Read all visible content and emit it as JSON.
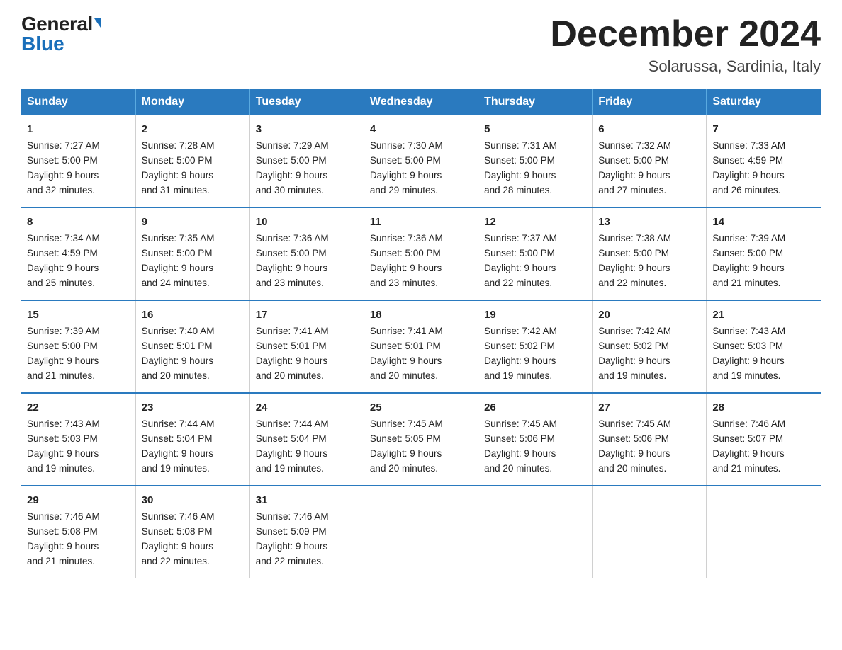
{
  "logo": {
    "general": "General",
    "blue": "Blue",
    "arrow": "▶"
  },
  "title": "December 2024",
  "subtitle": "Solarussa, Sardinia, Italy",
  "days": [
    "Sunday",
    "Monday",
    "Tuesday",
    "Wednesday",
    "Thursday",
    "Friday",
    "Saturday"
  ],
  "weeks": [
    [
      {
        "day": "1",
        "sunrise": "7:27 AM",
        "sunset": "5:00 PM",
        "daylight": "9 hours and 32 minutes."
      },
      {
        "day": "2",
        "sunrise": "7:28 AM",
        "sunset": "5:00 PM",
        "daylight": "9 hours and 31 minutes."
      },
      {
        "day": "3",
        "sunrise": "7:29 AM",
        "sunset": "5:00 PM",
        "daylight": "9 hours and 30 minutes."
      },
      {
        "day": "4",
        "sunrise": "7:30 AM",
        "sunset": "5:00 PM",
        "daylight": "9 hours and 29 minutes."
      },
      {
        "day": "5",
        "sunrise": "7:31 AM",
        "sunset": "5:00 PM",
        "daylight": "9 hours and 28 minutes."
      },
      {
        "day": "6",
        "sunrise": "7:32 AM",
        "sunset": "5:00 PM",
        "daylight": "9 hours and 27 minutes."
      },
      {
        "day": "7",
        "sunrise": "7:33 AM",
        "sunset": "4:59 PM",
        "daylight": "9 hours and 26 minutes."
      }
    ],
    [
      {
        "day": "8",
        "sunrise": "7:34 AM",
        "sunset": "4:59 PM",
        "daylight": "9 hours and 25 minutes."
      },
      {
        "day": "9",
        "sunrise": "7:35 AM",
        "sunset": "5:00 PM",
        "daylight": "9 hours and 24 minutes."
      },
      {
        "day": "10",
        "sunrise": "7:36 AM",
        "sunset": "5:00 PM",
        "daylight": "9 hours and 23 minutes."
      },
      {
        "day": "11",
        "sunrise": "7:36 AM",
        "sunset": "5:00 PM",
        "daylight": "9 hours and 23 minutes."
      },
      {
        "day": "12",
        "sunrise": "7:37 AM",
        "sunset": "5:00 PM",
        "daylight": "9 hours and 22 minutes."
      },
      {
        "day": "13",
        "sunrise": "7:38 AM",
        "sunset": "5:00 PM",
        "daylight": "9 hours and 22 minutes."
      },
      {
        "day": "14",
        "sunrise": "7:39 AM",
        "sunset": "5:00 PM",
        "daylight": "9 hours and 21 minutes."
      }
    ],
    [
      {
        "day": "15",
        "sunrise": "7:39 AM",
        "sunset": "5:00 PM",
        "daylight": "9 hours and 21 minutes."
      },
      {
        "day": "16",
        "sunrise": "7:40 AM",
        "sunset": "5:01 PM",
        "daylight": "9 hours and 20 minutes."
      },
      {
        "day": "17",
        "sunrise": "7:41 AM",
        "sunset": "5:01 PM",
        "daylight": "9 hours and 20 minutes."
      },
      {
        "day": "18",
        "sunrise": "7:41 AM",
        "sunset": "5:01 PM",
        "daylight": "9 hours and 20 minutes."
      },
      {
        "day": "19",
        "sunrise": "7:42 AM",
        "sunset": "5:02 PM",
        "daylight": "9 hours and 19 minutes."
      },
      {
        "day": "20",
        "sunrise": "7:42 AM",
        "sunset": "5:02 PM",
        "daylight": "9 hours and 19 minutes."
      },
      {
        "day": "21",
        "sunrise": "7:43 AM",
        "sunset": "5:03 PM",
        "daylight": "9 hours and 19 minutes."
      }
    ],
    [
      {
        "day": "22",
        "sunrise": "7:43 AM",
        "sunset": "5:03 PM",
        "daylight": "9 hours and 19 minutes."
      },
      {
        "day": "23",
        "sunrise": "7:44 AM",
        "sunset": "5:04 PM",
        "daylight": "9 hours and 19 minutes."
      },
      {
        "day": "24",
        "sunrise": "7:44 AM",
        "sunset": "5:04 PM",
        "daylight": "9 hours and 19 minutes."
      },
      {
        "day": "25",
        "sunrise": "7:45 AM",
        "sunset": "5:05 PM",
        "daylight": "9 hours and 20 minutes."
      },
      {
        "day": "26",
        "sunrise": "7:45 AM",
        "sunset": "5:06 PM",
        "daylight": "9 hours and 20 minutes."
      },
      {
        "day": "27",
        "sunrise": "7:45 AM",
        "sunset": "5:06 PM",
        "daylight": "9 hours and 20 minutes."
      },
      {
        "day": "28",
        "sunrise": "7:46 AM",
        "sunset": "5:07 PM",
        "daylight": "9 hours and 21 minutes."
      }
    ],
    [
      {
        "day": "29",
        "sunrise": "7:46 AM",
        "sunset": "5:08 PM",
        "daylight": "9 hours and 21 minutes."
      },
      {
        "day": "30",
        "sunrise": "7:46 AM",
        "sunset": "5:08 PM",
        "daylight": "9 hours and 22 minutes."
      },
      {
        "day": "31",
        "sunrise": "7:46 AM",
        "sunset": "5:09 PM",
        "daylight": "9 hours and 22 minutes."
      },
      null,
      null,
      null,
      null
    ]
  ]
}
